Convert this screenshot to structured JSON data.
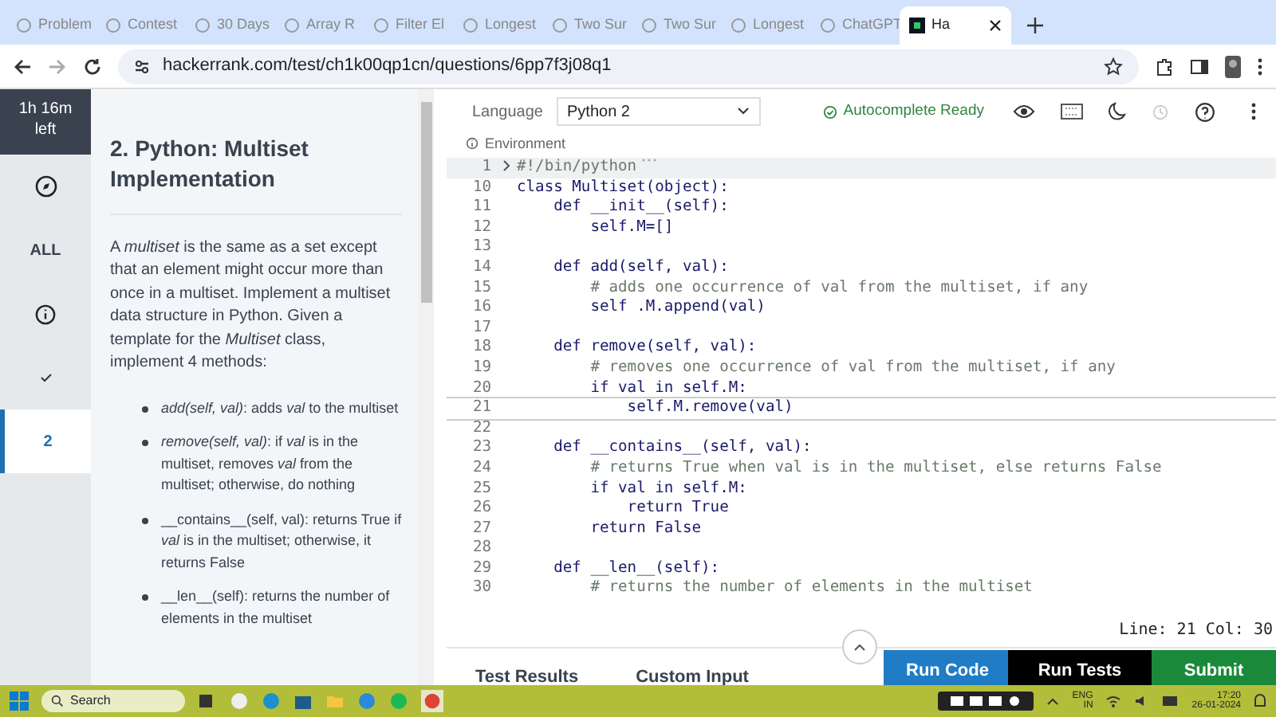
{
  "browser": {
    "tabs": [
      {
        "label": "Problem",
        "selected": false
      },
      {
        "label": "Contest",
        "selected": false
      },
      {
        "label": "30 Days",
        "selected": false
      },
      {
        "label": "Array R",
        "selected": false
      },
      {
        "label": "Filter El",
        "selected": false
      },
      {
        "label": "Longest",
        "selected": false
      },
      {
        "label": "Two Sur",
        "selected": false
      },
      {
        "label": "Two Sur",
        "selected": false
      },
      {
        "label": "Longest",
        "selected": false
      },
      {
        "label": "ChatGPT",
        "selected": false
      },
      {
        "label": "Ha",
        "selected": true
      }
    ],
    "url": "hackerrank.com/test/ch1k00qp1cn/questions/6pp7f3j08q1"
  },
  "rail": {
    "timer": "1h 16m left",
    "items": [
      {
        "kind": "icon",
        "selected": false
      },
      {
        "kind": "text",
        "label": "ALL",
        "selected": false
      },
      {
        "kind": "info",
        "selected": false
      },
      {
        "kind": "check",
        "selected": false
      },
      {
        "kind": "text",
        "label": "2",
        "selected": true
      }
    ]
  },
  "problem": {
    "title": "2. Python: Multiset Implementation",
    "intro": "A *multiset* is the same as a set except that an element might occur more than once in a multiset. Implement a multiset data structure in Python. Given a template for the *Multiset* class, implement 4 methods:",
    "bullets": [
      "*add(self, val)*: adds *val* to the multiset",
      "*remove(self, val)*: if *val* is in the multiset, removes *val* from the multiset; otherwise, do nothing",
      "__contains__(self, val): returns True if *val* is in the multiset; otherwise, it returns False",
      "__len__(self): returns the number of elements in the multiset"
    ]
  },
  "editor": {
    "language_label": "Language",
    "language": "Python 2",
    "environment": "Environment",
    "autocomplete": "Autocomplete Ready",
    "lines": [
      {
        "num": "1",
        "text": "#!/bin/python",
        "kind": "comment",
        "folded": true,
        "selected": false
      },
      {
        "num": "10",
        "text": "class Multiset(object):",
        "kind": "code",
        "folded": false,
        "selected": false
      },
      {
        "num": "11",
        "text": "    def __init__(self):",
        "kind": "code",
        "folded": false,
        "selected": false
      },
      {
        "num": "12",
        "text": "        self.M=[]",
        "kind": "code",
        "folded": false,
        "selected": false
      },
      {
        "num": "13",
        "folded": false,
        "selected": false
      },
      {
        "num": "14",
        "text": "    def add(self, val):",
        "kind": "code",
        "folded": false,
        "selected": false
      },
      {
        "num": "15",
        "text": "        # adds one occurrence of val from the multiset, if any",
        "kind": "comment",
        "folded": false,
        "selected": false
      },
      {
        "num": "16",
        "text": "        self .M.append(val)",
        "kind": "code",
        "folded": false,
        "selected": false
      },
      {
        "num": "17",
        "folded": false,
        "selected": false
      },
      {
        "num": "18",
        "text": "    def remove(self, val):",
        "kind": "code",
        "folded": false,
        "selected": false
      },
      {
        "num": "19",
        "text": "        # removes one occurrence of val from the multiset, if any",
        "kind": "comment",
        "folded": false,
        "selected": false
      },
      {
        "num": "20",
        "text": "        if val in self.M:",
        "kind": "code",
        "folded": false,
        "selected": false
      },
      {
        "num": "21",
        "text": "            self.M.remove(val)",
        "kind": "code",
        "folded": false,
        "selected": true
      },
      {
        "num": "22",
        "folded": false,
        "selected": false
      },
      {
        "num": "23",
        "text": "    def __contains__(self, val):",
        "kind": "code",
        "folded": false,
        "selected": false
      },
      {
        "num": "24",
        "text": "        # returns True when val is in the multiset, else returns False",
        "kind": "comment",
        "folded": false,
        "selected": false
      },
      {
        "num": "25",
        "text": "        if val in self.M:",
        "kind": "code",
        "folded": false,
        "selected": false
      },
      {
        "num": "26",
        "text": "            return True",
        "kind": "code",
        "folded": false,
        "selected": false
      },
      {
        "num": "27",
        "text": "        return False",
        "kind": "code",
        "folded": false,
        "selected": false
      },
      {
        "num": "28",
        "folded": false,
        "selected": false
      },
      {
        "num": "29",
        "text": "    def __len__(self):",
        "kind": "code",
        "folded": false,
        "selected": false
      },
      {
        "num": "30",
        "text": "        # returns the number of elements in the multiset",
        "kind": "comment",
        "folded": false,
        "selected": false
      }
    ],
    "position": "Line: 21 Col: 30"
  },
  "bottom": {
    "tabs": [
      "Test Results",
      "Custom Input"
    ],
    "buttons": [
      {
        "label": "Run Code",
        "kind": "run"
      },
      {
        "label": "Run Tests",
        "kind": "tests"
      },
      {
        "label": "Submit",
        "kind": "submit"
      }
    ]
  },
  "taskbar": {
    "search": "Search",
    "lang": "ENG",
    "region": "IN",
    "time": "17:20",
    "date": "26-01-2024"
  }
}
